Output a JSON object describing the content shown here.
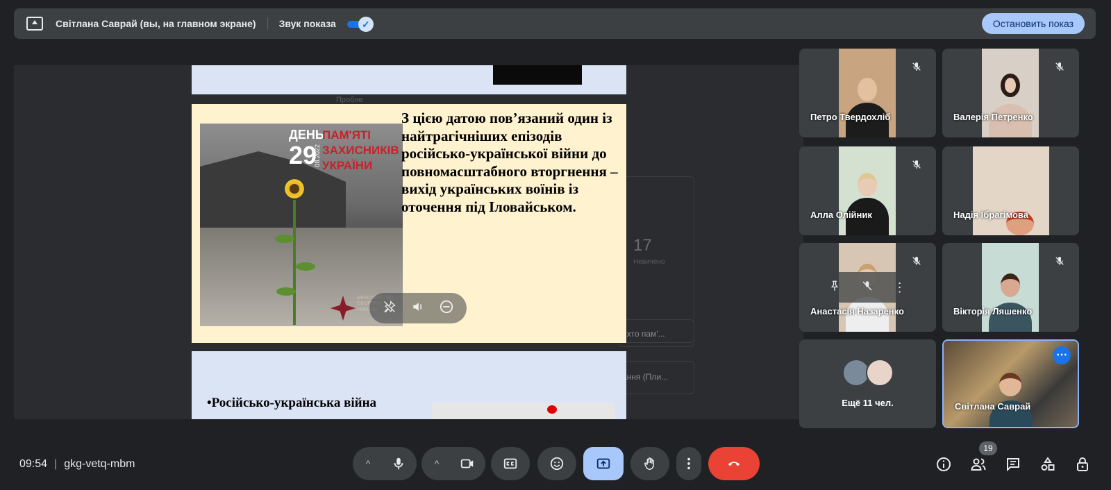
{
  "banner": {
    "presenter": "Світлана Саврай (вы, на главном экране)",
    "sound_label": "Звук показа",
    "stop_label": "Остановить показ"
  },
  "slide": {
    "poster_day": "ДЕНЬ",
    "poster_num": "29",
    "poster_date": "08.2022",
    "poster_line1": "ПАМ'ЯТІ",
    "poster_line2": "ЗАХИСНИКІВ",
    "poster_line3": "УКРАЇНИ",
    "ministry": "МІНІСТЕРСТВО ОБОРОНИ УКРАЇНИ",
    "text": "З цією датою пов’язаний один із найтрагічніших епізодів російсько-української війни до повномасштабного вторгнення – вихід українських воїнів із оточення під Іловайськом.",
    "bullet": "•Російсько-українська війна"
  },
  "background_doc": {
    "items": [
      "Пробне",
      "17",
      "Невичено",
      ", хто пам'...",
      "ання (Пли..."
    ]
  },
  "participants": [
    {
      "name": "Петро Твердохліб"
    },
    {
      "name": "Валерія Петренко"
    },
    {
      "name": "Алла Олійник"
    },
    {
      "name": "Надія Ібрагімова"
    },
    {
      "name": "Анастасія Назаренко"
    },
    {
      "name": "Вікторія Ляшенко"
    }
  ],
  "more": {
    "label": "Ещё 11 чел."
  },
  "self": {
    "name": "Світлана Саврай"
  },
  "footer": {
    "time": "09:54",
    "meeting_code": "gkg-vetq-mbm",
    "participant_count": "19"
  },
  "colors": {
    "accent": "#a8c7fa",
    "end_call": "#ea4335",
    "toggle": "#1a73e8",
    "tile": "#3c4043"
  }
}
